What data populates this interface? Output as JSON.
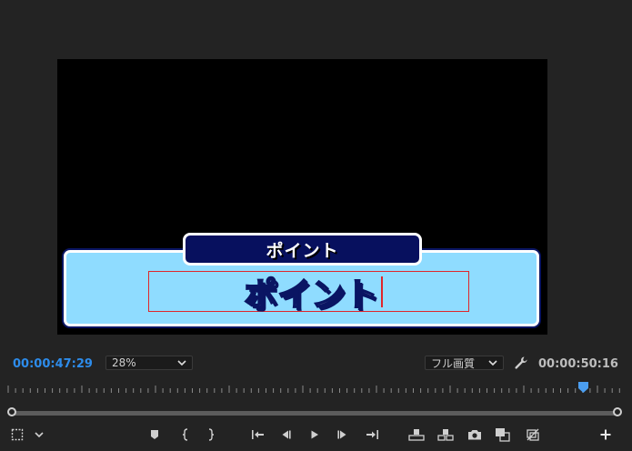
{
  "preview": {
    "header_label": "ポイント",
    "main_text": "ポイント"
  },
  "toolbar": {
    "current_timecode": "00:00:47:29",
    "zoom_value": "28%",
    "quality_value": "フル画質",
    "duration_timecode": "00:00:50:16"
  },
  "controls": {
    "icons": [
      "safe-margins-icon",
      "settings-chevron-icon",
      "add-marker-icon",
      "mark-in-icon",
      "mark-out-icon",
      "go-to-in-icon",
      "step-back-icon",
      "play-icon",
      "step-forward-icon",
      "go-to-out-icon",
      "lift-icon",
      "extract-icon",
      "export-frame-icon",
      "comparison-view-icon",
      "proxy-toggle-icon",
      "add-button-icon"
    ]
  },
  "colors": {
    "background": "#232323",
    "accent_blue": "#2d8ceb",
    "lower_third_fill": "#8fdcff",
    "lower_third_header": "#07105e",
    "selection_red": "#e0252b"
  }
}
